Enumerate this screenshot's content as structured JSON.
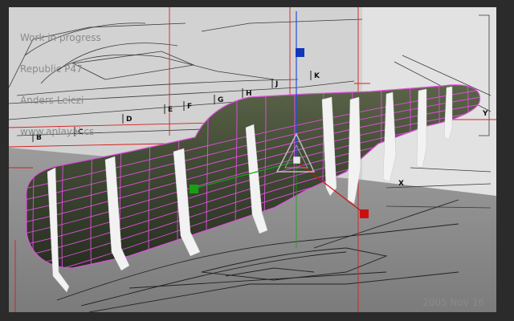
{
  "caption": {
    "line1": "Work in progress",
    "line2": "Republic P47",
    "line3": "Anders Leiczi",
    "line4": "www.aplayai.cs"
  },
  "date_label": "2005 Nov 16",
  "station_labels": [
    "B",
    "C",
    "D",
    "E",
    "F",
    "G",
    "H",
    "J",
    "K"
  ],
  "axis_labels": [
    "Y",
    "X"
  ],
  "colors": {
    "background": "#2b2b2b",
    "viewport_bg": "#e4e4e4",
    "fuselage": "#3c4632",
    "wireframe": "#e24fe0",
    "gizmo_y": "#2050e0",
    "gizmo_x": "#16a016",
    "gizmo_z": "#cc1010",
    "guide": "#d42020"
  },
  "icons": [
    "move-gizmo-icon",
    "handle-y-icon",
    "handle-x-icon",
    "handle-z-icon"
  ]
}
